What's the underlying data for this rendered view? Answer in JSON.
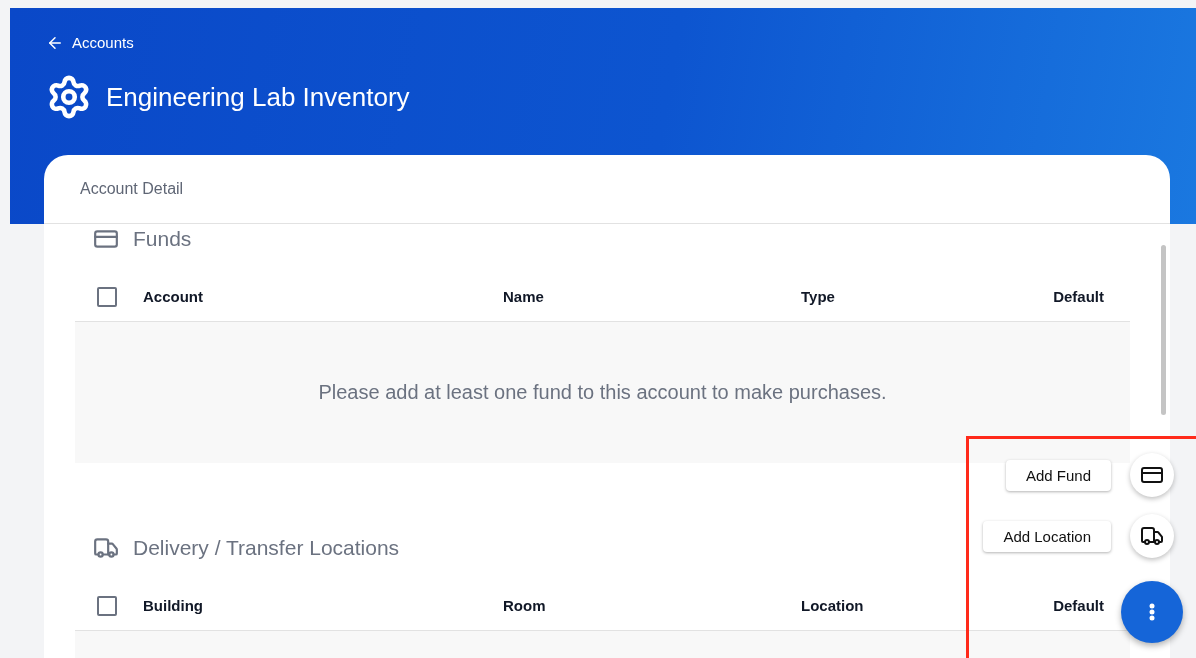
{
  "header": {
    "back_link": "Accounts",
    "title": "Engineering Lab Inventory"
  },
  "card": {
    "title": "Account Detail"
  },
  "sections": [
    {
      "title": "Funds",
      "kind": "card",
      "select_all": {
        "checked": false
      },
      "columns": [
        "Account",
        "Name",
        "Type",
        "Default"
      ],
      "empty_message": "Please add at least one fund to this account to make purchases."
    },
    {
      "title": "Delivery / Transfer Locations",
      "kind": "truck",
      "select_all": {
        "checked": false
      },
      "columns": [
        "Building",
        "Room",
        "Location",
        "Default"
      ]
    }
  ],
  "speed_dial": {
    "open": true,
    "actions": [
      {
        "label": "Add Fund",
        "kind": "card"
      },
      {
        "label": "Add Location",
        "kind": "truck"
      }
    ]
  }
}
